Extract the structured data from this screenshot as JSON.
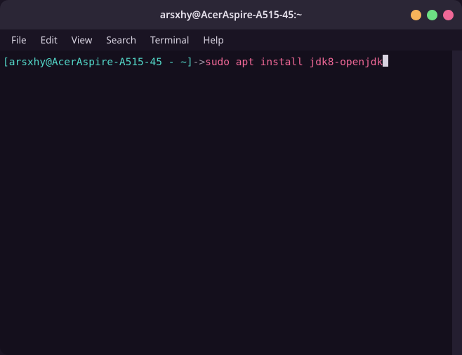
{
  "window": {
    "title": "arsxhy@AcerAspire-A515-45:~"
  },
  "menu": {
    "file": "File",
    "edit": "Edit",
    "view": "View",
    "search": "Search",
    "terminal": "Terminal",
    "help": "Help"
  },
  "prompt": {
    "user_host": "[arsxhy@AcerAspire-A515-45 - ~]",
    "separator": "->",
    "command": "sudo apt install jdk8-openjdk"
  },
  "colors": {
    "bg": "#140f1c",
    "titlebar": "#2b2636",
    "prompt": "#53d7c8",
    "command": "#f06897",
    "min": "#f5b35a",
    "max": "#6de184",
    "close": "#f06897"
  }
}
